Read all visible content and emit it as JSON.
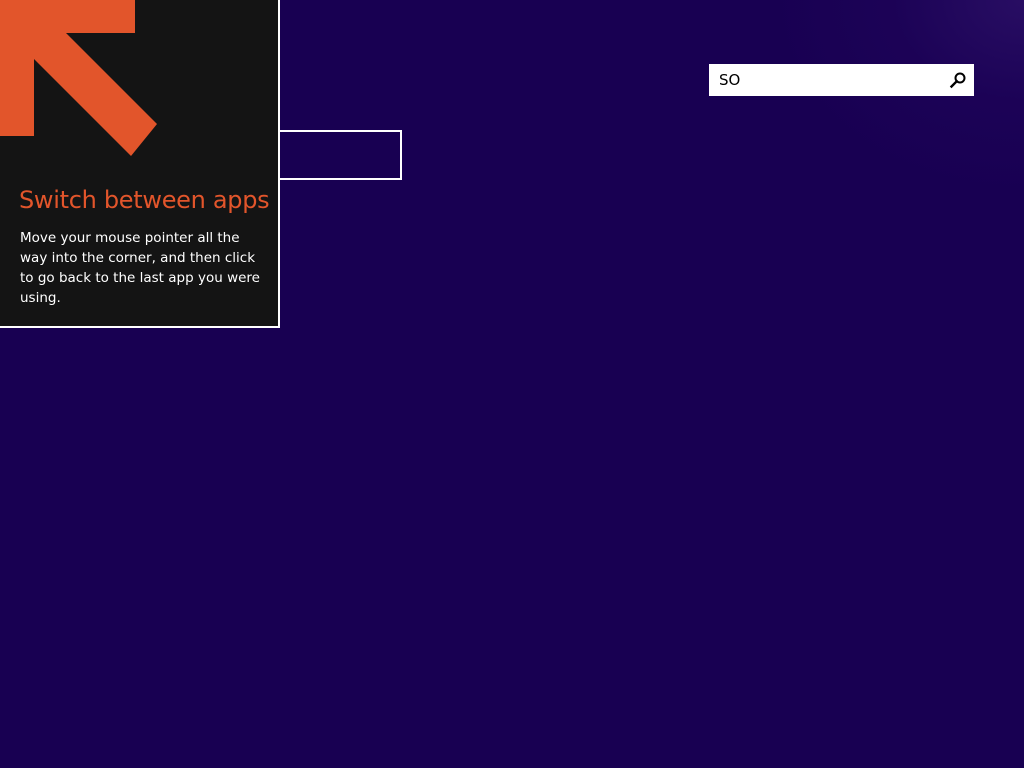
{
  "search": {
    "value": "SO",
    "icon": "search-icon"
  },
  "tip": {
    "icon": "arrow-up-left-icon",
    "title": "Switch between apps",
    "body": "Move your mouse pointer all the way into the corner, and then click to go back to the last app you were using."
  },
  "colors": {
    "background": "#180052",
    "accent": "#e2552b",
    "panel": "#141414",
    "search_box": "#ffffff"
  }
}
